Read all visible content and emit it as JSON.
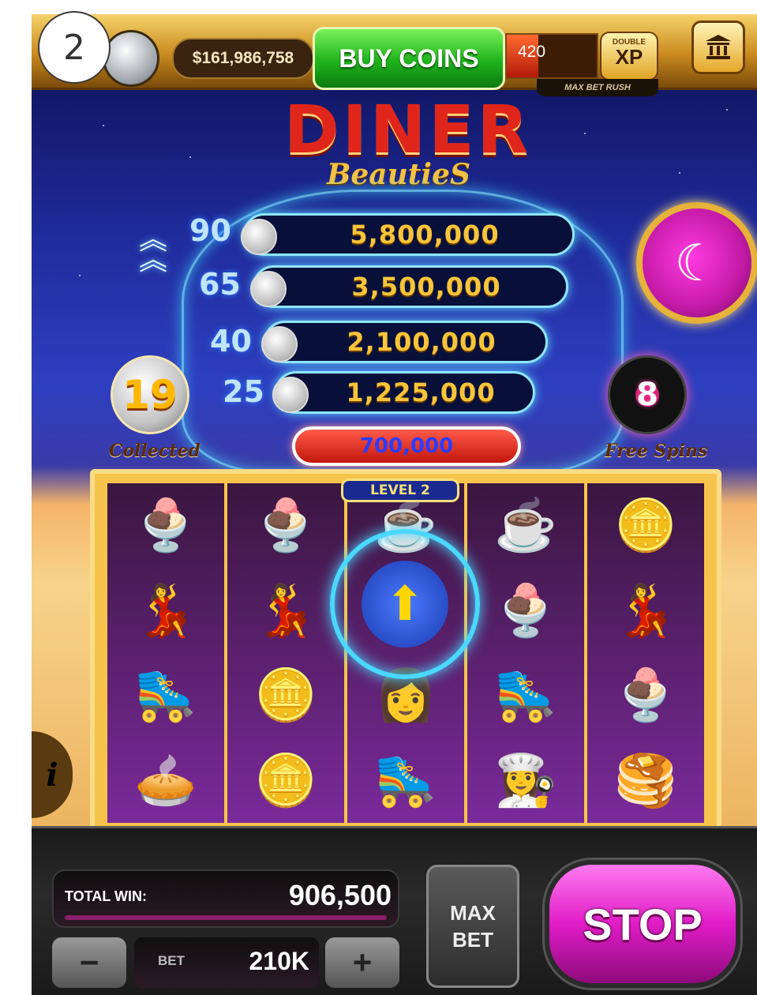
{
  "step_badge": "2",
  "header": {
    "balance": "$161,986,758",
    "buy_coins": "BUY COINS",
    "xp_value": "420",
    "xp_progress": 0.35,
    "max_bet_rush": "MAX BET RUSH",
    "double_xp_top": "DOUBLE",
    "double_xp_main": "XP"
  },
  "game": {
    "logo_main": "DINER",
    "logo_sub": "BeautieS",
    "jackpots": [
      {
        "count": "90",
        "value": "5,800,000"
      },
      {
        "count": "65",
        "value": "3,500,000"
      },
      {
        "count": "40",
        "value": "2,100,000"
      },
      {
        "count": "25",
        "value": "1,225,000"
      }
    ],
    "base_jackpot": "700,000",
    "collected_count": "19",
    "collected_label": "Collected",
    "free_spins_count": "8",
    "free_spins_label": "Free Spins",
    "level_tag": "LEVEL 2",
    "reels": [
      [
        "🍨",
        "💃",
        "🛼",
        "🥧"
      ],
      [
        "🍨",
        "💃",
        "🪙",
        "🪙"
      ],
      [
        "☕",
        "⬆",
        "👩",
        "🛼"
      ],
      [
        "☕",
        "🍨",
        "🛼",
        "👩‍🍳"
      ],
      [
        "🪙",
        "💃",
        "🍨",
        "🥞"
      ]
    ],
    "info_glyph": "i"
  },
  "controls": {
    "total_win_label": "TOTAL WIN:",
    "total_win_value": "906,500",
    "bet_label": "BET",
    "bet_value": "210K",
    "minus": "−",
    "plus": "+",
    "max_bet_line1": "MAX",
    "max_bet_line2": "BET",
    "stop": "STOP"
  }
}
